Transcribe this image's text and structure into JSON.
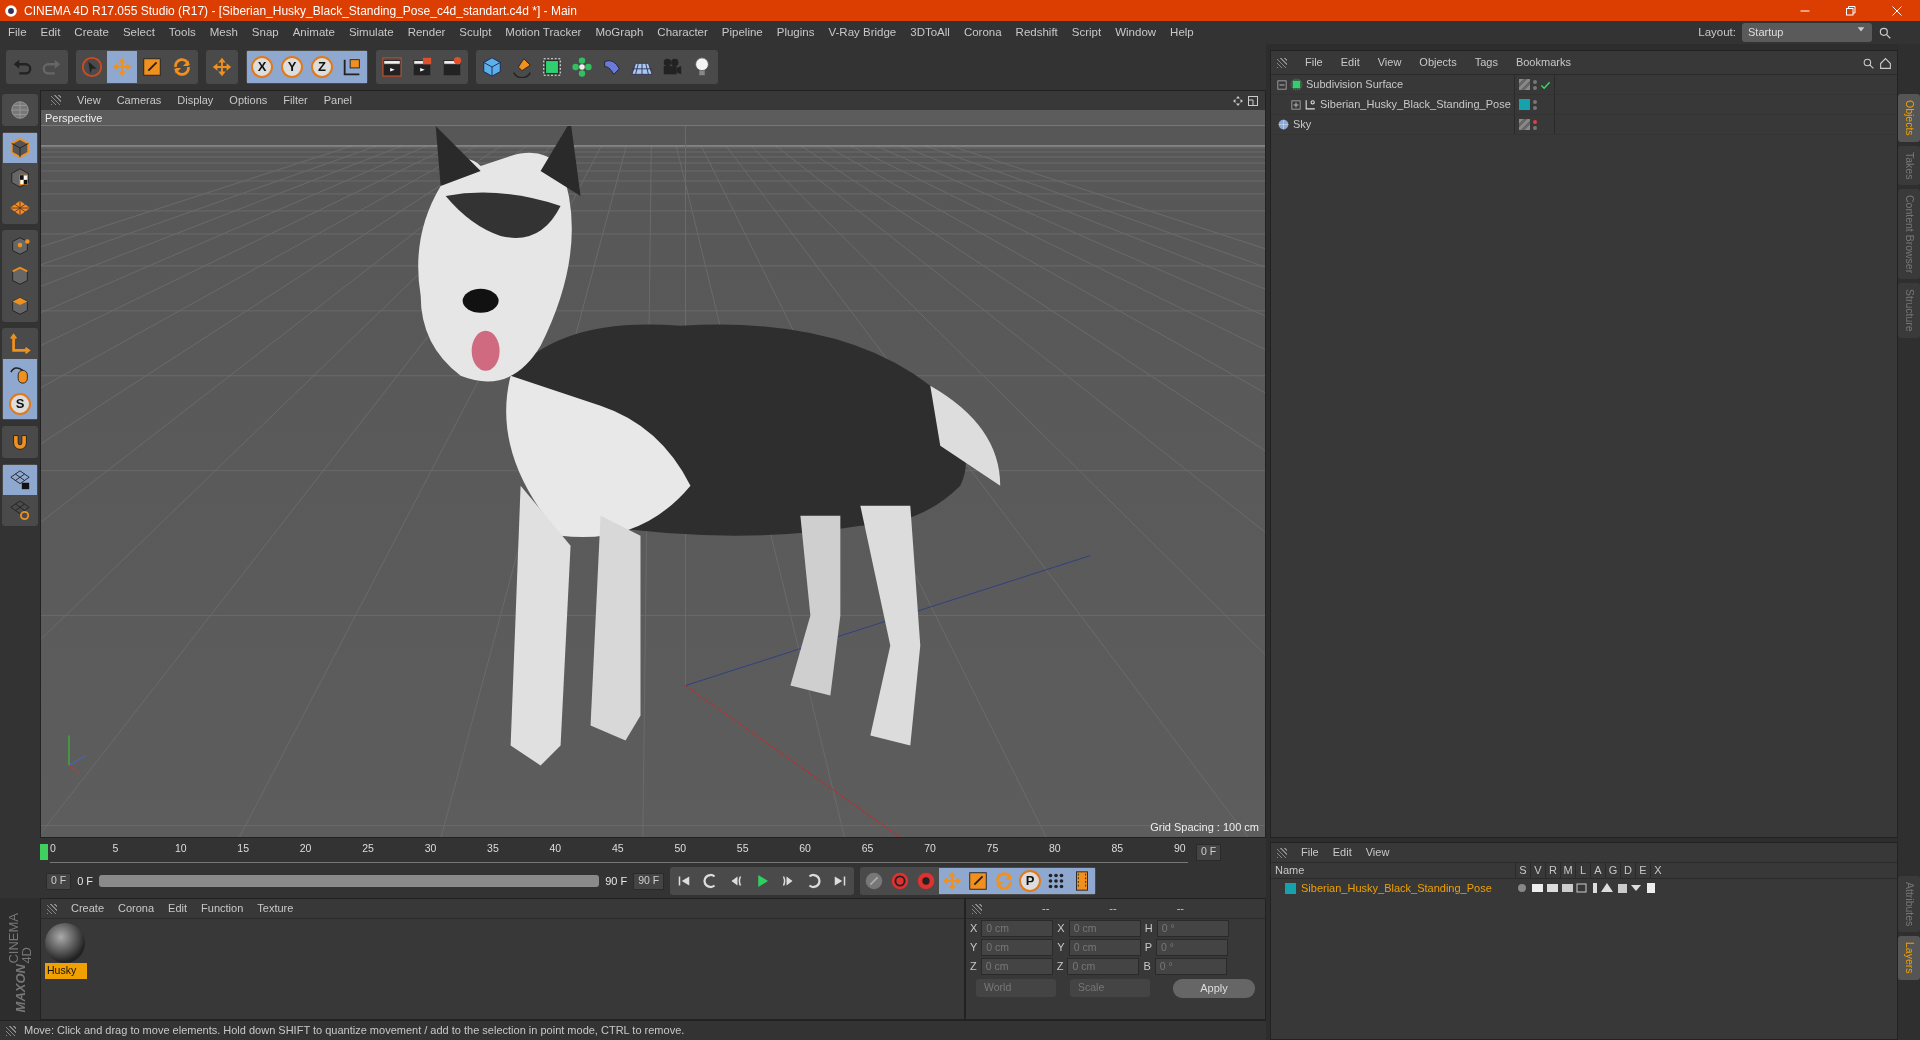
{
  "window": {
    "title": "CINEMA 4D R17.055 Studio (R17) - [Siberian_Husky_Black_Standing_Pose_c4d_standart.c4d *] - Main"
  },
  "menu": [
    "File",
    "Edit",
    "Create",
    "Select",
    "Tools",
    "Mesh",
    "Snap",
    "Animate",
    "Simulate",
    "Render",
    "Sculpt",
    "Motion Tracker",
    "MoGraph",
    "Character",
    "Pipeline",
    "Plugins",
    "V-Ray Bridge",
    "3DToAll",
    "Corona",
    "Redshift",
    "Script",
    "Window",
    "Help"
  ],
  "layout": {
    "label": "Layout:",
    "value": "Startup"
  },
  "toolbar": [
    [
      {
        "kind": "undo",
        "selected": false
      },
      {
        "kind": "redo",
        "selected": false
      }
    ],
    [
      {
        "kind": "select",
        "selected": false
      },
      {
        "kind": "move",
        "selected": true
      },
      {
        "kind": "scale",
        "selected": false
      },
      {
        "kind": "rotate",
        "selected": false
      }
    ],
    [
      {
        "kind": "transform",
        "selected": false
      }
    ],
    [
      {
        "kind": "axis",
        "label": "X",
        "selected": true
      },
      {
        "kind": "axis",
        "label": "Y",
        "selected": true
      },
      {
        "kind": "axis",
        "label": "Z",
        "selected": true
      },
      {
        "kind": "coordinates",
        "selected": true
      }
    ],
    [
      {
        "kind": "render-view",
        "selected": false
      },
      {
        "kind": "render",
        "selected": false
      },
      {
        "kind": "render-settings",
        "selected": false
      }
    ],
    [
      {
        "kind": "cube",
        "selected": false
      },
      {
        "kind": "pen",
        "selected": false
      },
      {
        "kind": "subdivision",
        "selected": false
      },
      {
        "kind": "cloner",
        "selected": false
      },
      {
        "kind": "deformer",
        "selected": false
      },
      {
        "kind": "floor",
        "selected": false
      },
      {
        "kind": "camera",
        "selected": false
      },
      {
        "kind": "light",
        "selected": false
      }
    ]
  ],
  "left_tools": [
    [
      {
        "kind": "editable",
        "selected": false
      }
    ],
    [
      {
        "kind": "model",
        "selected": true
      },
      {
        "kind": "texture",
        "selected": false
      },
      {
        "kind": "workplane",
        "selected": false
      }
    ],
    [
      {
        "kind": "points",
        "selected": false
      },
      {
        "kind": "edges",
        "selected": false
      },
      {
        "kind": "polygons",
        "selected": false
      }
    ],
    [
      {
        "kind": "axis-mode",
        "selected": false
      },
      {
        "kind": "tweak",
        "selected": true
      },
      {
        "kind": "snap",
        "label": "S",
        "selected": true
      }
    ],
    [
      {
        "kind": "magnet",
        "selected": false
      }
    ],
    [
      {
        "kind": "lock-workplane",
        "selected": true
      },
      {
        "kind": "workplane-cycle",
        "selected": false
      }
    ]
  ],
  "viewport": {
    "menu": [
      "View",
      "Cameras",
      "Display",
      "Options",
      "Filter",
      "Panel"
    ],
    "camera": "Perspective",
    "grid_spacing": "Grid Spacing : 100 cm"
  },
  "timeline": {
    "ticks": [
      "0",
      "5",
      "10",
      "15",
      "20",
      "25",
      "30",
      "35",
      "40",
      "45",
      "50",
      "55",
      "60",
      "65",
      "70",
      "75",
      "80",
      "85",
      "90"
    ],
    "current": "0 F",
    "start": "0 F",
    "range": {
      "start": "0 F",
      "end": "90 F",
      "level": 1
    },
    "end": "90 F",
    "transport": [
      {
        "kind": "first"
      },
      {
        "kind": "prev-key"
      },
      {
        "kind": "prev-frame"
      },
      {
        "kind": "play"
      },
      {
        "kind": "next-frame"
      },
      {
        "kind": "next-key"
      },
      {
        "kind": "last"
      }
    ],
    "keys": [
      {
        "kind": "key-off",
        "selected": false
      },
      {
        "kind": "record",
        "selected": false
      },
      {
        "kind": "autokey",
        "selected": false
      },
      {
        "kind": "move",
        "selected": true
      },
      {
        "kind": "scale",
        "selected": true
      },
      {
        "kind": "rotate",
        "selected": true
      },
      {
        "kind": "param",
        "label": "P",
        "selected": true
      },
      {
        "kind": "points-grid",
        "selected": true
      },
      {
        "kind": "film",
        "selected": true
      }
    ]
  },
  "materials": {
    "menu": [
      "Create",
      "Corona",
      "Edit",
      "Function",
      "Texture"
    ],
    "items": [
      {
        "name": "Husky",
        "selected": true
      }
    ]
  },
  "coordinates": {
    "headers": [
      "--",
      "--",
      "--"
    ],
    "rows": [
      [
        "X",
        "0 cm",
        "X",
        "0 cm",
        "H",
        "0 °"
      ],
      [
        "Y",
        "0 cm",
        "Y",
        "0 cm",
        "P",
        "0 °"
      ],
      [
        "Z",
        "0 cm",
        "Z",
        "0 cm",
        "B",
        "0 °"
      ]
    ],
    "mode": "World",
    "size_mode": "Scale",
    "apply": "Apply"
  },
  "status_bar": "Move: Click and drag to move elements. Hold down SHIFT to quantize movement / add to the selection in point mode, CTRL to remove.",
  "brand": [
    "MAXON",
    "CINEMA 4D"
  ],
  "objects": {
    "menu": [
      "File",
      "Edit",
      "View",
      "Objects",
      "Tags",
      "Bookmarks"
    ],
    "items": [
      {
        "name": "Subdivision Surface",
        "kind": "subdivision",
        "expanded": true,
        "enabled": true,
        "hidden": false,
        "children": [
          {
            "name": "Siberian_Husky_Black_Standing_Pose",
            "kind": "null",
            "expanded": false,
            "hidden": false,
            "color": "#16a2ad"
          }
        ]
      },
      {
        "name": "Sky",
        "kind": "sky",
        "hidden": true
      }
    ]
  },
  "layers": {
    "menu": [
      "File",
      "Edit",
      "View"
    ],
    "columns": [
      "Name",
      "S",
      "V",
      "R",
      "M",
      "L",
      "A",
      "G",
      "D",
      "E",
      "X"
    ],
    "items": [
      {
        "name": "Siberian_Husky_Black_Standing_Pose",
        "color": "#16a2ad"
      }
    ]
  },
  "side_tabs_top": [
    {
      "label": "Objects",
      "selected": true
    },
    {
      "label": "Takes",
      "selected": false
    },
    {
      "label": "Content Browser",
      "selected": false
    },
    {
      "label": "Structure",
      "selected": false
    }
  ],
  "side_tabs_bottom": [
    {
      "label": "Attributes",
      "selected": false
    },
    {
      "label": "Layers",
      "selected": true
    }
  ]
}
